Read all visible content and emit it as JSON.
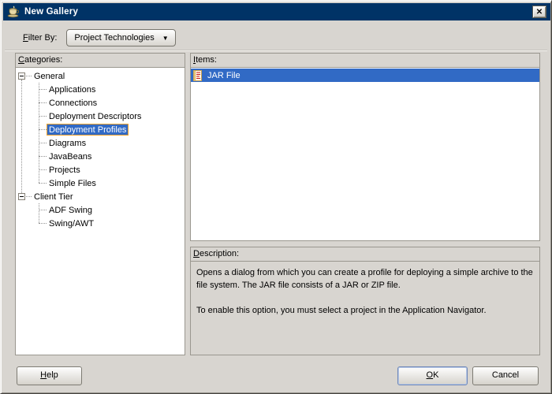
{
  "window": {
    "title": "New Gallery",
    "close_glyph": "✕"
  },
  "filter": {
    "label_mn": "F",
    "label_rest": "ilter By:",
    "value": "Project Technologies",
    "arrow": "▼"
  },
  "categories": {
    "label_mn": "C",
    "label_rest": "ategories:",
    "selected": "Deployment Profiles",
    "groups": [
      {
        "label": "General",
        "children": [
          "Applications",
          "Connections",
          "Deployment Descriptors",
          "Deployment Profiles",
          "Diagrams",
          "JavaBeans",
          "Projects",
          "Simple Files"
        ]
      },
      {
        "label": "Client Tier",
        "children": [
          "ADF Swing",
          "Swing/AWT"
        ]
      }
    ]
  },
  "items": {
    "label_mn": "I",
    "label_rest": "tems:",
    "list": [
      {
        "label": "JAR File",
        "icon": "jar-file-icon",
        "selected": true
      }
    ]
  },
  "description": {
    "label_mn": "D",
    "label_rest": "escription:",
    "paragraphs": [
      "Opens a dialog from which you can create a profile for deploying a simple archive to the file system. The JAR file consists of a JAR or ZIP file.",
      "To enable this option, you must select a project in the Application Navigator."
    ]
  },
  "buttons": {
    "help_mn": "H",
    "help_rest": "elp",
    "ok_mn": "O",
    "ok_rest": "K",
    "cancel": "Cancel"
  },
  "colors": {
    "title_bar": "#003366",
    "selection_blue": "#316ac5",
    "tree_selection_border": "#f0a22c",
    "dialog_bg": "#d8d5d0"
  }
}
